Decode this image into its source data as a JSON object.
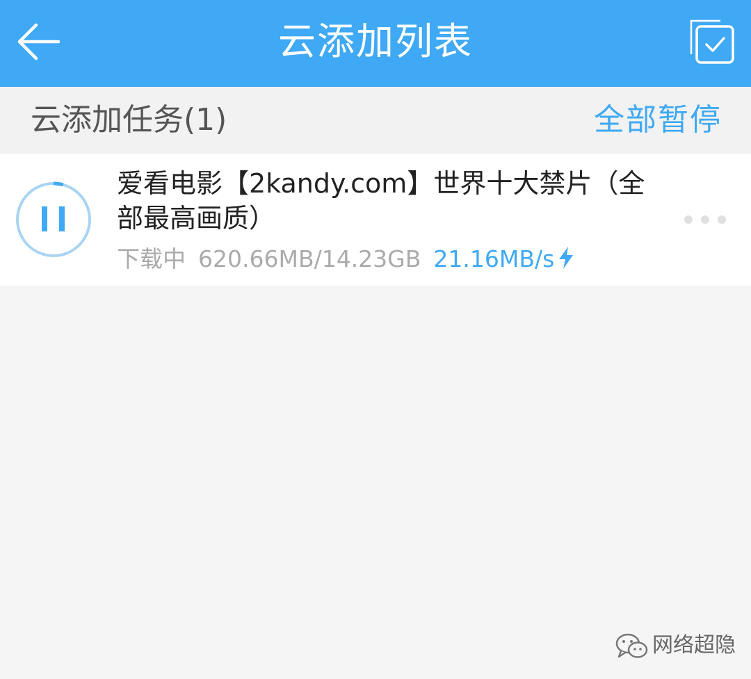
{
  "appbar": {
    "title": "云添加列表",
    "back_icon": "arrow-left-icon",
    "select_icon": "multi-select-check-icon",
    "background_color": "#3fa9f5"
  },
  "section": {
    "title": "云添加任务(1)",
    "pause_all_label": "全部暂停"
  },
  "tasks": [
    {
      "title": "爱看电影【2kandy.com】世界十大禁片（全部最高画质）",
      "status": "下载中",
      "size": "620.66MB/14.23GB",
      "speed": "21.16MB/s",
      "progress": 0.0426,
      "state_icon": "pause-icon",
      "more_icon": "more-dots-icon",
      "speed_icon": "lightning-icon"
    }
  ],
  "watermark": {
    "text": "网络超隐",
    "icon": "wechat-icon"
  },
  "colors": {
    "accent": "#3fa9f5",
    "ring_track": "#a9d4f3",
    "muted_text": "#aaaaaa"
  }
}
